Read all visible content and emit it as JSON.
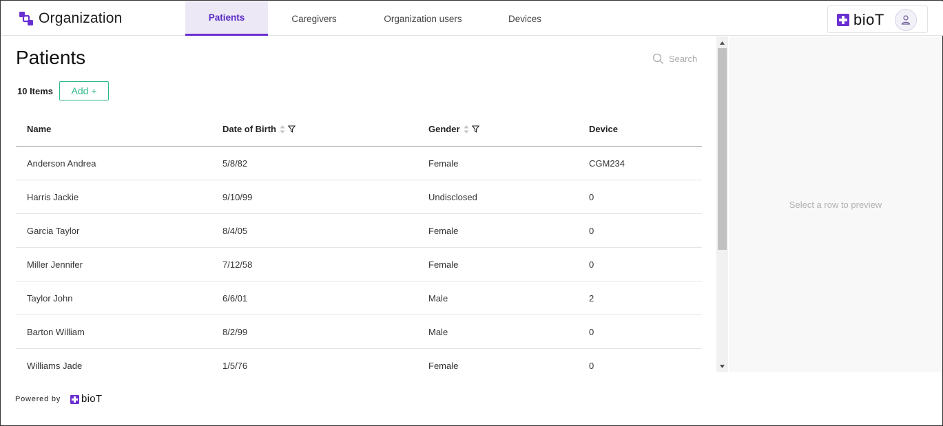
{
  "header": {
    "title": "Organization",
    "brand": "bioT",
    "tabs": [
      {
        "label": "Patients",
        "active": true
      },
      {
        "label": "Caregivers",
        "active": false
      },
      {
        "label": "Organization users",
        "active": false
      },
      {
        "label": "Devices",
        "active": false
      }
    ]
  },
  "main": {
    "title": "Patients",
    "search_placeholder": "Search",
    "items_count": "10 Items",
    "add_label": "Add +",
    "columns": [
      "Name",
      "Date of Birth",
      "Gender",
      "Device"
    ],
    "rows": [
      {
        "name": "Anderson Andrea",
        "dob": "5/8/82",
        "gender": "Female",
        "device": "CGM234"
      },
      {
        "name": "Harris Jackie",
        "dob": "9/10/99",
        "gender": "Undisclosed",
        "device": "0"
      },
      {
        "name": "Garcia Taylor",
        "dob": "8/4/05",
        "gender": "Female",
        "device": "0"
      },
      {
        "name": "Miller Jennifer",
        "dob": "7/12/58",
        "gender": "Female",
        "device": "0"
      },
      {
        "name": "Taylor John",
        "dob": "6/6/01",
        "gender": "Male",
        "device": "2"
      },
      {
        "name": "Barton William",
        "dob": "8/2/99",
        "gender": "Male",
        "device": "0"
      },
      {
        "name": "Williams Jade",
        "dob": "1/5/76",
        "gender": "Female",
        "device": "0"
      }
    ]
  },
  "preview": {
    "empty_text": "Select a row to preview"
  },
  "footer": {
    "powered_by": "Powered by",
    "brand": "bioT"
  },
  "colors": {
    "brand_purple": "#6a2fd1",
    "active_tab_bg": "#ece8f6",
    "add_green": "#2db887"
  }
}
